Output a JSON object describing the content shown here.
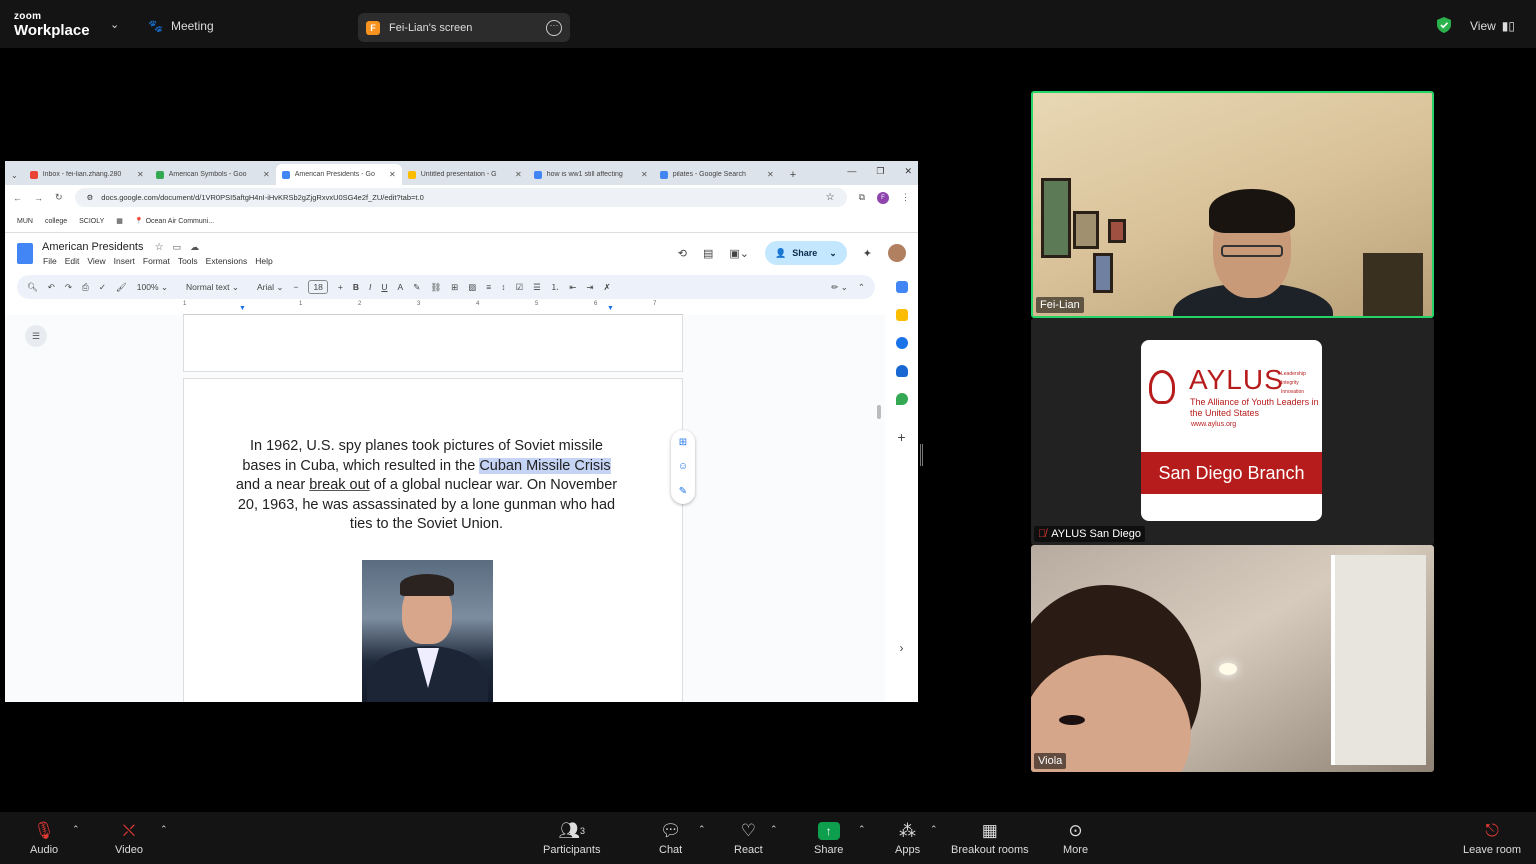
{
  "topbar": {
    "logo_top": "zoom",
    "logo_bottom": "Workplace",
    "meeting_label": "Meeting",
    "screen_badge": "F",
    "screen_label": "Fei-Lian's screen",
    "view_label": "View"
  },
  "browser": {
    "tabs": [
      {
        "title": "Inbox - fei-lian.zhang.280",
        "icon_color": "#ea4335"
      },
      {
        "title": "American Symbols - Goo",
        "icon_color": "#34a853"
      },
      {
        "title": "American Presidents - Go",
        "icon_color": "#4285f4",
        "active": true
      },
      {
        "title": "Untitled presentation - G",
        "icon_color": "#fbbc04"
      },
      {
        "title": "how is ww1 still affecting",
        "icon_color": "#4285f4"
      },
      {
        "title": "pilates - Google Search",
        "icon_color": "#4285f4"
      }
    ],
    "url": "docs.google.com/document/d/1VR0PSI5aftgH4nI-iHvKRSb2gZjgRxvxU0SG4e2f_ZU/edit?tab=t.0",
    "bookmarks": [
      "MUN",
      "college",
      "SCIOLY",
      "Ocean Air Communi..."
    ],
    "profile_initial": "F"
  },
  "docs": {
    "title": "American Presidents",
    "menu": [
      "File",
      "Edit",
      "View",
      "Insert",
      "Format",
      "Tools",
      "Extensions",
      "Help"
    ],
    "share_label": "Share",
    "zoom": "100%",
    "style": "Normal text",
    "font": "Arial",
    "font_size": "18",
    "ruler_ticks": [
      "1",
      "1",
      "2",
      "3",
      "4",
      "5",
      "6",
      "7"
    ],
    "text": {
      "part1": "In 1962, U.S. spy planes took pictures of Soviet missile bases in Cuba, which resulted in the ",
      "highlight": "Cuban Missile Crisis",
      "part2": " and a near ",
      "underlined": "break out",
      "part3": " of a global nuclear war. On November 20, 1963, he was assassinated by a lone gunman who had ties to the Soviet Union."
    }
  },
  "participants": [
    {
      "name": "Fei-Lian",
      "active_speaker": true
    },
    {
      "name": "AYLUS San Diego",
      "muted": true
    },
    {
      "name": "Viola"
    }
  ],
  "aylus_card": {
    "wordmark": "AYLUS",
    "tagline": [
      "Leadership",
      "Integrity",
      "Innovation"
    ],
    "subtitle": "The Alliance of Youth Leaders in the United States",
    "website": "www.aylus.org",
    "branch": "San Diego Branch",
    "brand_color": "#b71c1c"
  },
  "controls": {
    "audio": "Audio",
    "video": "Video",
    "participants": "Participants",
    "participants_count": "3",
    "chat": "Chat",
    "react": "React",
    "share": "Share",
    "apps": "Apps",
    "breakout": "Breakout rooms",
    "more": "More",
    "leave": "Leave room"
  }
}
